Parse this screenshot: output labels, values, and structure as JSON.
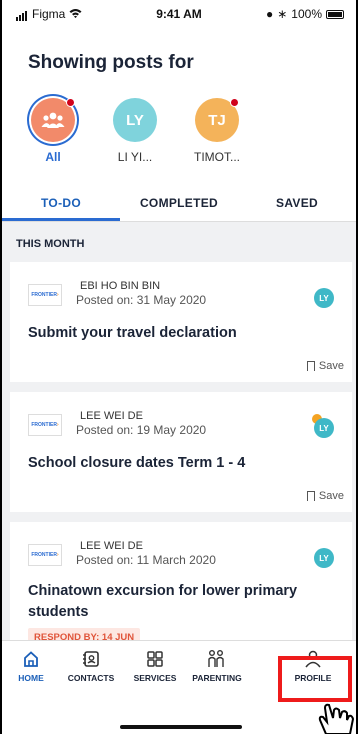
{
  "status_bar": {
    "carrier": "Figma",
    "time": "9:41 AM",
    "battery": "100%"
  },
  "header": {
    "title": "Showing posts for"
  },
  "profiles": [
    {
      "initials": "",
      "label": "All",
      "icon": "group-icon",
      "color": "#f28a6a",
      "selected": true,
      "has_dot": true
    },
    {
      "initials": "LY",
      "label": "LI YI...",
      "color": "#7fd3dc",
      "selected": false,
      "has_dot": false
    },
    {
      "initials": "TJ",
      "label": "TIMOT...",
      "color": "#f4b35a",
      "selected": false,
      "has_dot": true
    }
  ],
  "tabs": [
    {
      "label": "TO-DO",
      "active": true
    },
    {
      "label": "COMPLETED",
      "active": false
    },
    {
      "label": "SAVED",
      "active": false
    }
  ],
  "section_title": "THIS MONTH",
  "posts": [
    {
      "author": "EBI HO BIN BIN",
      "posted": "Posted on: 31 May 2020",
      "title": "Submit your travel declaration",
      "badge": "LY",
      "save_label": "Save",
      "logo_text": "FRONTIER"
    },
    {
      "author": "LEE WEI DE",
      "posted": "Posted on: 19 May 2020",
      "title": "School closure dates Term 1 - 4",
      "badge": "LY",
      "save_label": "Save",
      "logo_text": "FRONTIER"
    },
    {
      "author": "LEE WEI DE",
      "posted": "Posted on: 11 March 2020",
      "title": "Chinatown excursion for lower primary students",
      "badge": "LY",
      "respond_by": "RESPOND BY: 14 JUN",
      "logo_text": "FRONTIER"
    }
  ],
  "nav": [
    {
      "label": "HOME",
      "icon": "home-icon",
      "active": true
    },
    {
      "label": "CONTACTS",
      "icon": "contacts-icon",
      "active": false
    },
    {
      "label": "SERVICES",
      "icon": "grid-icon",
      "active": false
    },
    {
      "label": "PARENTING",
      "icon": "family-icon",
      "active": false
    },
    {
      "label": "PROFILE",
      "icon": "person-icon",
      "active": false
    }
  ]
}
